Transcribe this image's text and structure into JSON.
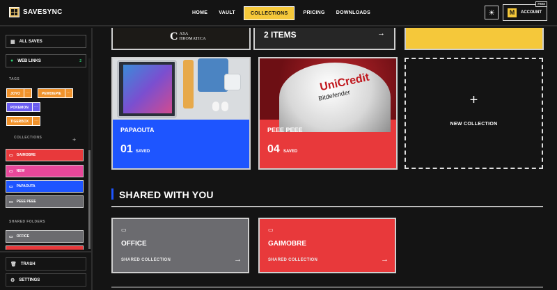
{
  "app": {
    "name": "SAVESYNC"
  },
  "nav": {
    "items": [
      {
        "label": "HOME",
        "active": false
      },
      {
        "label": "VAULT",
        "active": false
      },
      {
        "label": "COLLECTIONS",
        "active": true
      },
      {
        "label": "PRICING",
        "active": false
      },
      {
        "label": "DOWNLOADS",
        "active": false
      }
    ]
  },
  "account": {
    "label": "ACCOUNT",
    "plan_badge": "FREE",
    "avatar_letter": "M"
  },
  "sidebar": {
    "all_saves": "ALL SAVES",
    "web_links": {
      "label": "WEB LINKS",
      "count": "2"
    },
    "tags_heading": "TAGS",
    "tags": [
      {
        "label": "JOYO",
        "color": "#f0922b"
      },
      {
        "label": "PEWDIEPIE",
        "color": "#f0922b"
      },
      {
        "label": "POKEMON",
        "color": "#6a5cf0"
      },
      {
        "label": "TIGERBOX",
        "color": "#f0922b"
      }
    ],
    "more_glyph": "···",
    "collections_heading": "COLLECTIONS",
    "collections": [
      {
        "label": "GAIMOBRE",
        "color": "#e8393b"
      },
      {
        "label": "NEW",
        "color": "#e8479a"
      },
      {
        "label": "PAPAOUTA",
        "color": "#1e55ff"
      },
      {
        "label": "PEEE PEEE",
        "color": "#6b6b6f"
      }
    ],
    "shared_heading": "SHARED FOLDERS",
    "shared_folders": [
      {
        "label": "OFFICE",
        "color": "#6b6b6f"
      }
    ],
    "trash": "TRASH",
    "settings": "SETTINGS"
  },
  "main": {
    "top_row": {
      "image_logo_lines": [
        "ASA",
        "HROMATICA"
      ],
      "items_label": "2 ITEMS"
    },
    "collections": [
      {
        "title": "PAPAOUTA",
        "count": "01",
        "saved_label": "SAVED",
        "color": "#1e55ff"
      },
      {
        "title": "PEEE PEEE",
        "count": "04",
        "saved_label": "SAVED",
        "color": "#e8393b"
      }
    ],
    "new_collection_label": "NEW COLLECTION",
    "shared_section_title": "SHARED WITH YOU",
    "shared": [
      {
        "name": "OFFICE",
        "sub": "SHARED COLLECTION",
        "color": "#6b6b6f"
      },
      {
        "name": "GAIMOBRE",
        "sub": "SHARED COLLECTION",
        "color": "#e8393b"
      }
    ],
    "image_text": {
      "brand": "UniCredit",
      "brand_sub": "Bitdefender"
    }
  },
  "colors": {
    "accent": "#f5c83a",
    "background": "#141414",
    "blue": "#1e55ff",
    "red": "#e8393b",
    "gray": "#6b6b6f",
    "pink": "#e8479a",
    "orange": "#f0922b",
    "purple": "#6a5cf0",
    "green": "#2ecc71"
  }
}
